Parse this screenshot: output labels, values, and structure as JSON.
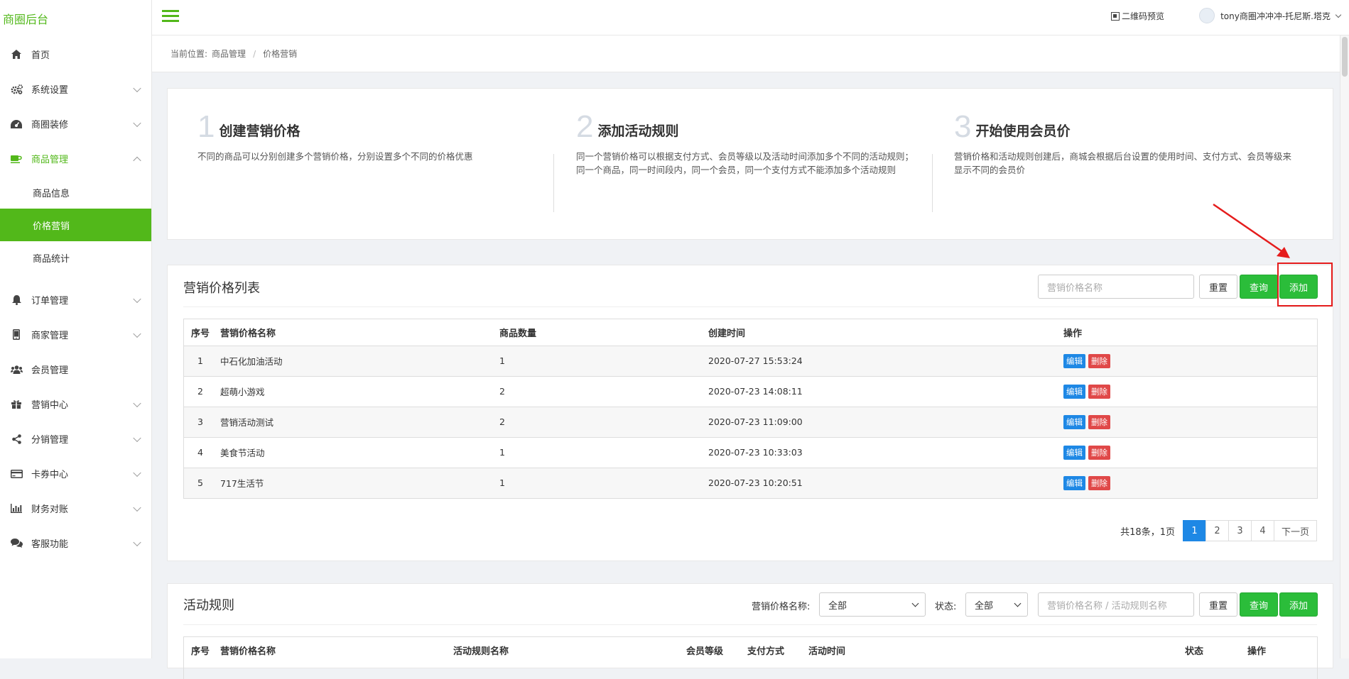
{
  "brand": "商圈后台",
  "sidebar": {
    "items": [
      {
        "label": "首页",
        "icon": "home-icon"
      },
      {
        "label": "系统设置",
        "icon": "gears-icon"
      },
      {
        "label": "商圈装修",
        "icon": "dashboard-icon"
      },
      {
        "label": "商品管理",
        "icon": "coffee-icon"
      },
      {
        "label": "订单管理",
        "icon": "bell-icon"
      },
      {
        "label": "商家管理",
        "icon": "mobile-icon"
      },
      {
        "label": "会员管理",
        "icon": "users-icon"
      },
      {
        "label": "营销中心",
        "icon": "gift-icon"
      },
      {
        "label": "分销管理",
        "icon": "share-icon"
      },
      {
        "label": "卡券中心",
        "icon": "credit-card-icon"
      },
      {
        "label": "财务对账",
        "icon": "bar-chart-icon"
      },
      {
        "label": "客服功能",
        "icon": "comments-icon"
      }
    ],
    "sub_items": [
      "商品信息",
      "价格营销",
      "商品统计"
    ]
  },
  "topbar": {
    "qr_label": "二维码预览",
    "user_name": "tony商圈冲冲冲-托尼斯.塔克"
  },
  "breadcrumb": {
    "prefix": "当前位置:",
    "level1": "商品管理",
    "sep": "/",
    "level2": "价格营销"
  },
  "steps": [
    {
      "num": "1",
      "title": "创建营销价格",
      "desc": "不同的商品可以分别创建多个营销价格，分别设置多个不同的价格优惠"
    },
    {
      "num": "2",
      "title": "添加活动规则",
      "desc": "同一个营销价格可以根据支付方式、会员等级以及活动时间添加多个不同的活动规则；同一个商品，同一时间段内，同一个会员，同一个支付方式不能添加多个活动规则"
    },
    {
      "num": "3",
      "title": "开始使用会员价",
      "desc": "营销价格和活动规则创建后，商城会根据后台设置的使用时间、支付方式、会员等级来显示不同的会员价"
    }
  ],
  "price_list": {
    "title": "营销价格列表",
    "search_placeholder": "营销价格名称",
    "reset_label": "重置",
    "query_label": "查询",
    "add_label": "添加",
    "columns": [
      "序号",
      "营销价格名称",
      "商品数量",
      "创建时间",
      "操作"
    ],
    "rows": [
      [
        "1",
        "中石化加油活动",
        "1",
        "2020-07-27 15:53:24"
      ],
      [
        "2",
        "超萌小游戏",
        "2",
        "2020-07-23 14:08:11"
      ],
      [
        "3",
        "营销活动测试",
        "2",
        "2020-07-23 11:09:00"
      ],
      [
        "4",
        "美食节活动",
        "1",
        "2020-07-23 10:33:03"
      ],
      [
        "5",
        "717生活节",
        "1",
        "2020-07-23 10:20:51"
      ]
    ],
    "edit_label": "编辑",
    "delete_label": "删除",
    "pager": {
      "total": "共18条，1页",
      "pages": [
        "1",
        "2",
        "3",
        "4"
      ],
      "current": "1",
      "next": "下一页"
    }
  },
  "rules": {
    "title": "活动规则",
    "filter_name_label": "营销价格名称:",
    "filter_name_value": "全部",
    "filter_status_label": "状态:",
    "filter_status_value": "全部",
    "search_placeholder": "营销价格名称 / 活动规则名称",
    "reset_label": "重置",
    "query_label": "查询",
    "add_label": "添加",
    "columns": [
      "序号",
      "营销价格名称",
      "活动规则名称",
      "会员等级",
      "支付方式",
      "活动时间",
      "状态",
      "操作"
    ]
  },
  "colors": {
    "brand_green": "#52b81a",
    "button_green": "#2bbd3a",
    "edit_blue": "#1e88e5",
    "delete_red": "#e04848",
    "annotation_red": "#e51c1c"
  }
}
